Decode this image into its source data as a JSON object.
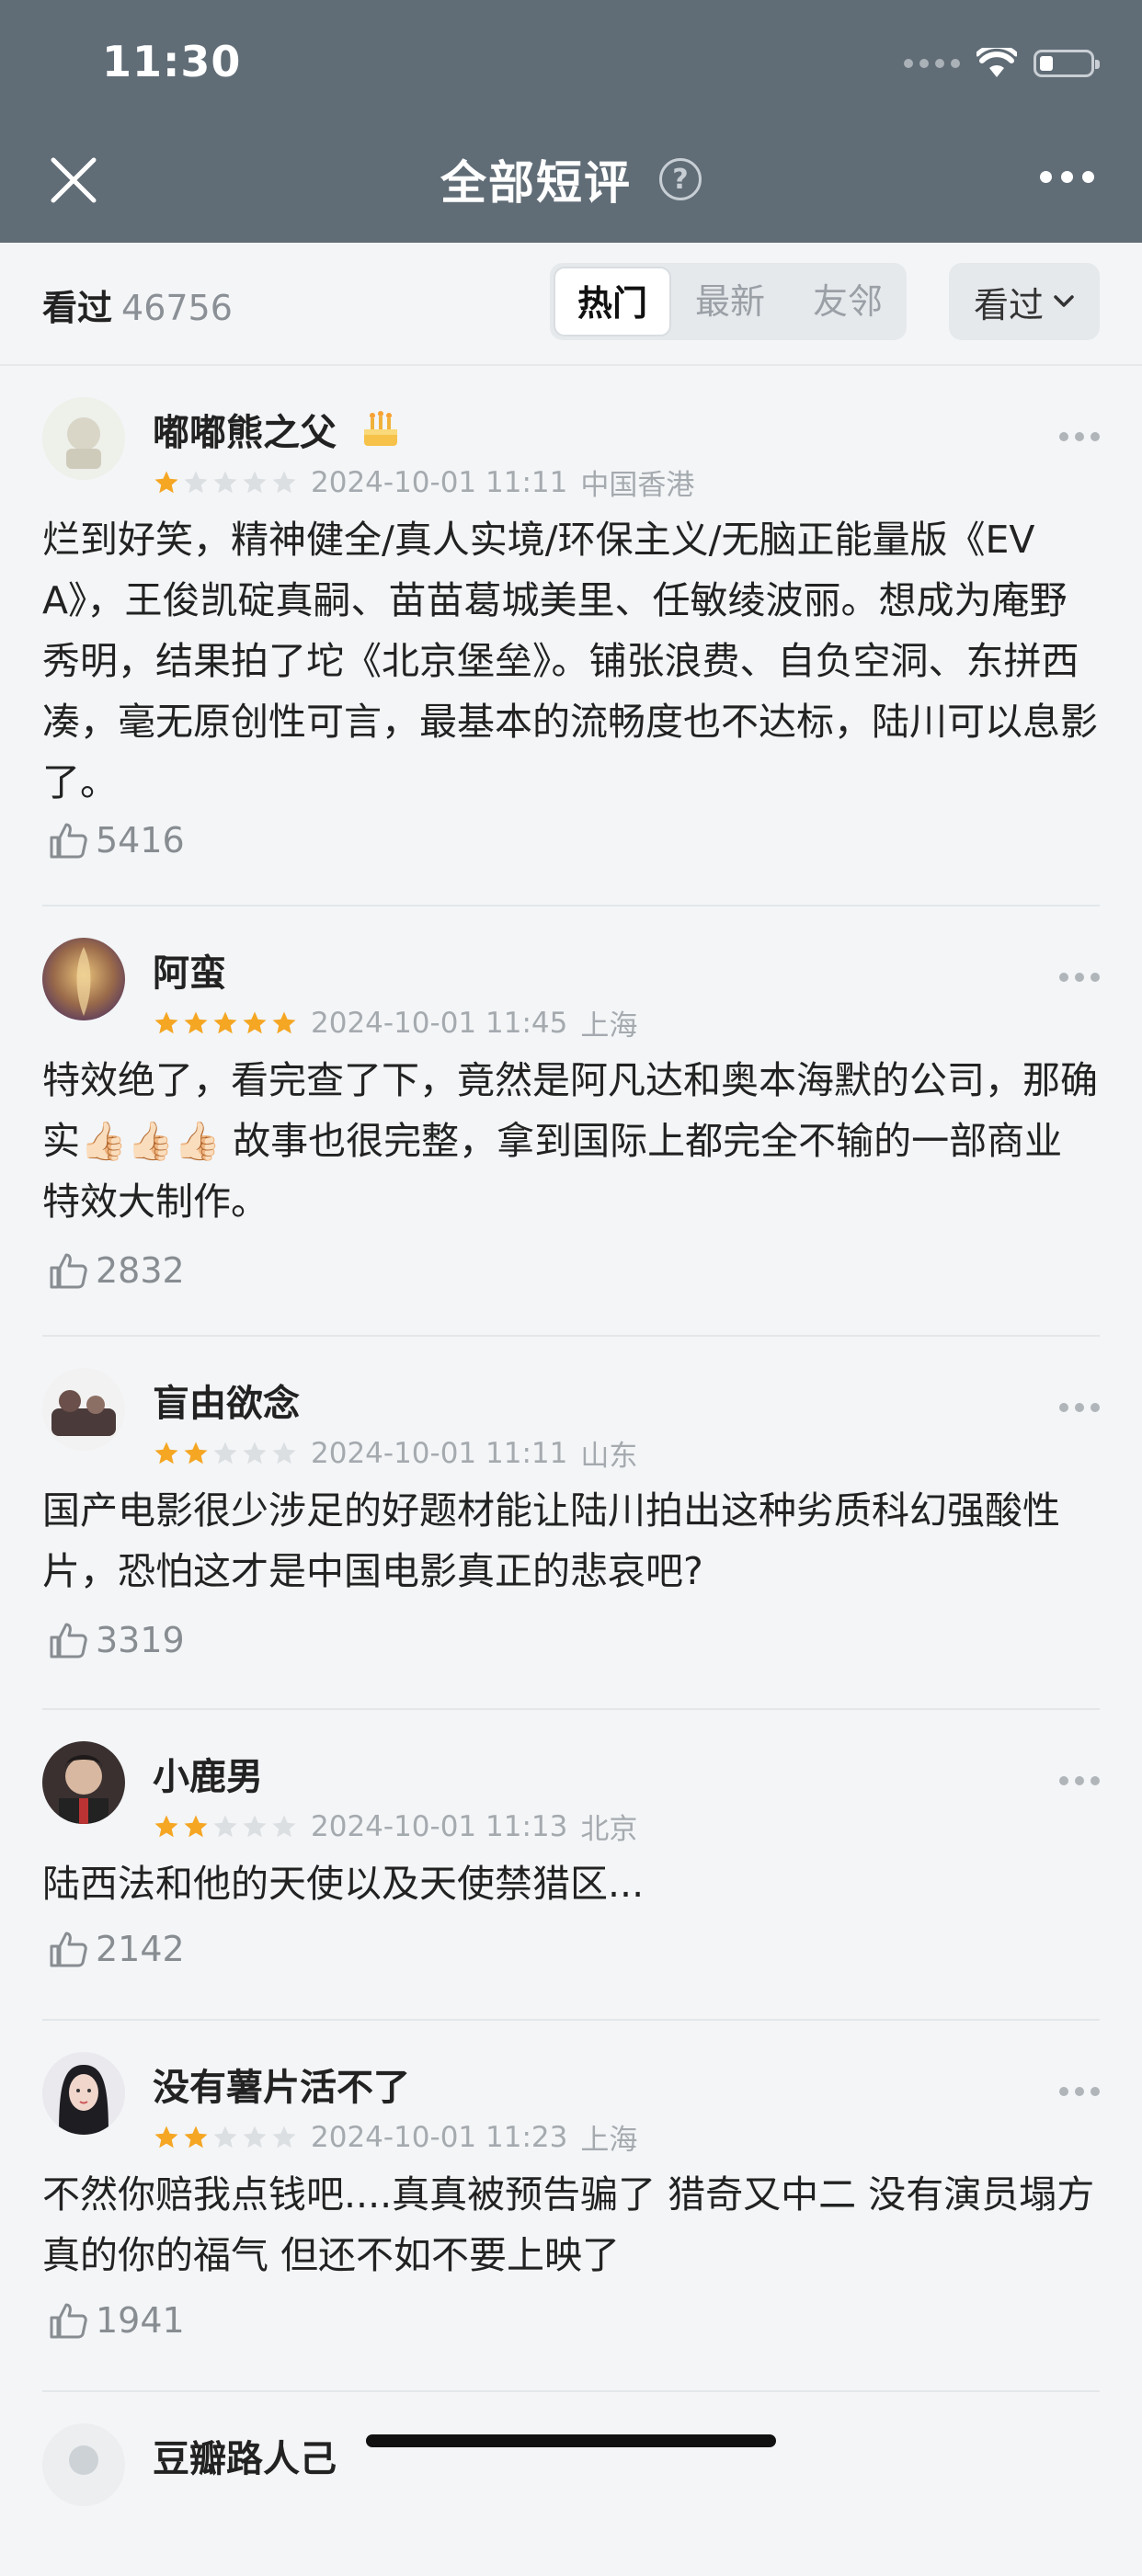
{
  "status_bar": {
    "time": "11:30"
  },
  "header": {
    "title": "全部短评",
    "help_icon": "question-circle-icon"
  },
  "filter": {
    "watched_label": "看过",
    "watched_count": "46756",
    "tabs": [
      {
        "label": "热门",
        "active": true
      },
      {
        "label": "最新",
        "active": false
      },
      {
        "label": "友邻",
        "active": false
      }
    ],
    "dropdown_label": "看过"
  },
  "colors": {
    "header_bg": "#606c76",
    "star": "#f5a623",
    "star_empty": "#dcdfe2"
  },
  "reviews": [
    {
      "user": "嘟嘟熊之父",
      "badge": "birthday-cake-icon",
      "rating": 1,
      "time": "2024-10-01 11:11",
      "location": "中国香港",
      "content": "烂到好笑，精神健全/真人实境/环保主义/无脑正能量版《EVA》，王俊凯碇真嗣、苗苗葛城美里、任敏绫波丽。想成为庵野秀明，结果拍了坨《北京堡垒》。铺张浪费、自负空洞、东拼西凑，毫无原创性可言，最基本的流畅度也不达标，陆川可以息影了。",
      "likes": "5416"
    },
    {
      "user": "阿蛮",
      "rating": 5,
      "time": "2024-10-01 11:45",
      "location": "上海",
      "content": "特效绝了，看完查了下，竟然是阿凡达和奥本海默的公司，那确实👍🏻👍🏻👍🏻 故事也很完整，拿到国际上都完全不输的一部商业特效大制作。",
      "likes": "2832"
    },
    {
      "user": "盲由欲念",
      "rating": 2,
      "time": "2024-10-01 11:11",
      "location": "山东",
      "content": "国产电影很少涉足的好题材能让陆川拍出这种劣质科幻强酸性片，恐怕这才是中国电影真正的悲哀吧?",
      "likes": "3319"
    },
    {
      "user": "小鹿男",
      "rating": 2,
      "time": "2024-10-01 11:13",
      "location": "北京",
      "content": "陆西法和他的天使以及天使禁猎区...",
      "likes": "2142"
    },
    {
      "user": "没有薯片活不了",
      "rating": 2,
      "time": "2024-10-01 11:23",
      "location": "上海",
      "content": "不然你赔我点钱吧....真真被预告骗了 猎奇又中二 没有演员塌方真的你的福气 但还不如不要上映了",
      "likes": "1941"
    },
    {
      "user": "豆瓣路人己"
    }
  ]
}
